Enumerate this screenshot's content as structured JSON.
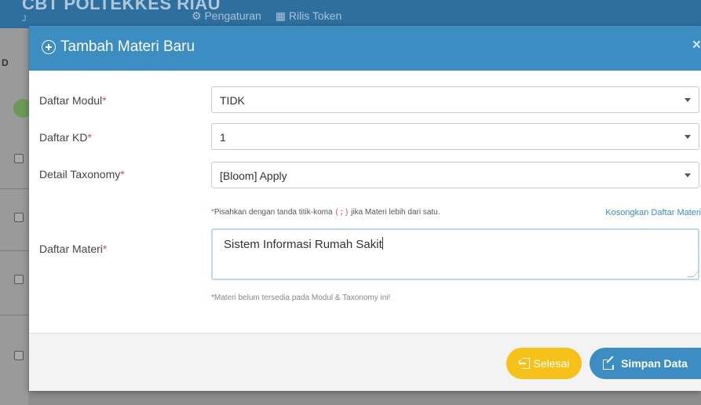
{
  "background": {
    "brand": "CBT POLTEKKES RIAU",
    "brand_sub": "J",
    "nav": [
      "⚙ Pengaturan",
      "▦ Rilis Token"
    ],
    "side_label": "D"
  },
  "modal": {
    "title": "Tambah Materi Baru",
    "close_label": "×",
    "fields": {
      "modul": {
        "label": "Daftar Modul",
        "value": "TIDK"
      },
      "kd": {
        "label": "Daftar KD",
        "value": "1"
      },
      "taxonomy": {
        "label": "Detail Taxonomy",
        "value": "[Bloom] Apply"
      },
      "materi": {
        "label": "Daftar Materi",
        "value": "Sistem Informasi Rumah Sakit"
      }
    },
    "required_mark": "*",
    "hint_before": "Pisahkan dengan tanda titik-koma",
    "hint_code": "(;)",
    "hint_after": "jika Materi lebih dari satu.",
    "clear_link": "Kosongkan Daftar Materi",
    "note": "Materi belum tersedia pada Modul & Taxonomy ini!",
    "buttons": {
      "selesai": "Selesai",
      "simpan": "Simpan Data"
    }
  },
  "colors": {
    "primary": "#3b8dc2",
    "warning": "#f6c118",
    "required": "#d9534f"
  }
}
